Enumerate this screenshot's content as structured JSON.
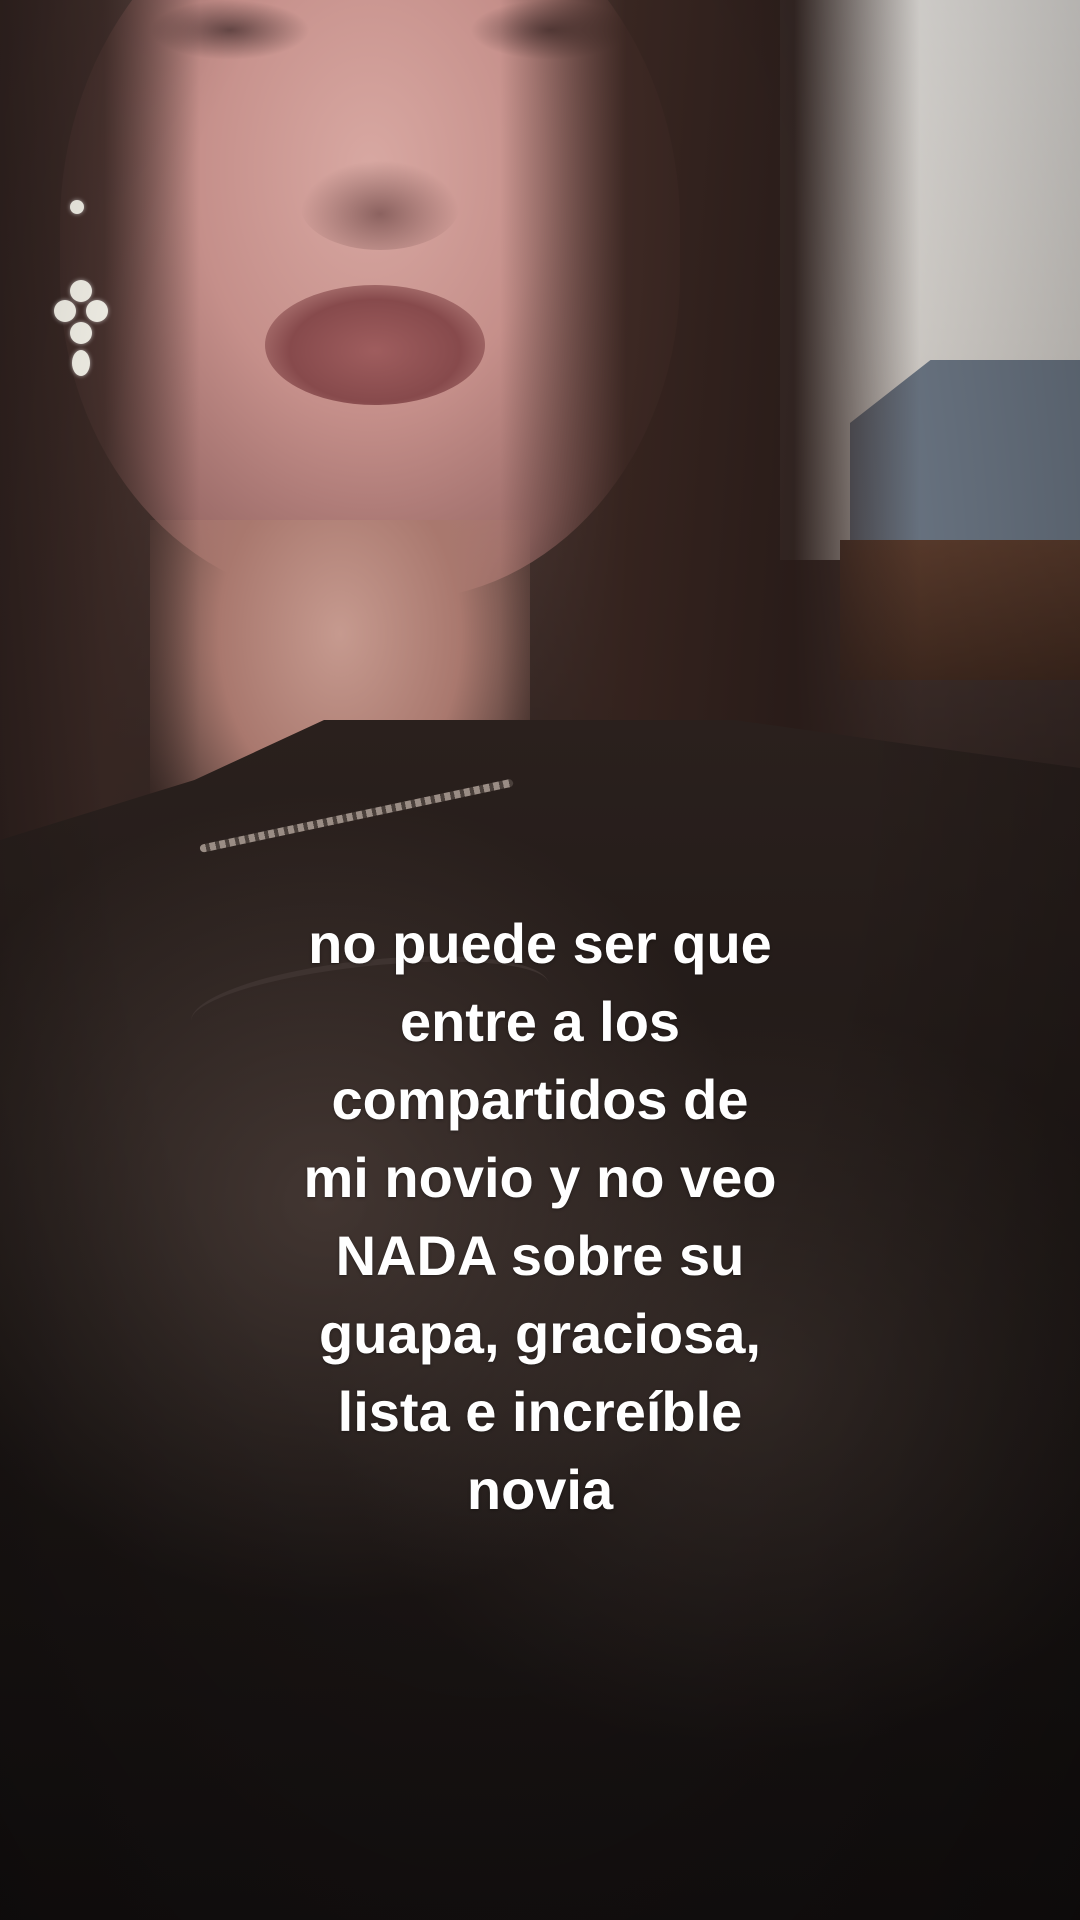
{
  "caption": {
    "lines": [
      "no puede ser que",
      "entre a los",
      "compartidos de",
      "mi novio y no veo",
      "NADA sobre su",
      "guapa, graciosa,",
      "lista e increíble",
      "novia"
    ],
    "color": "#ffffff"
  },
  "photo": {
    "subject": "selfie-portrait",
    "jacket_color": "#1d1715",
    "hair_color": "#34221d",
    "wall_color": "#e2ded9"
  }
}
